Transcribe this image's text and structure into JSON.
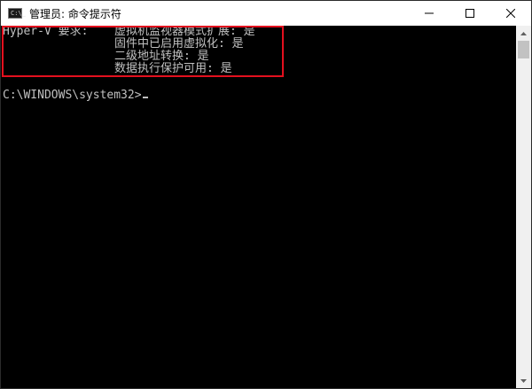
{
  "window": {
    "title": "管理员: 命令提示符",
    "app_icon_glyph": "C:\\_"
  },
  "console": {
    "hyper_v_label": "Hyper-V 要求:",
    "requirements": [
      "虚拟机监视器模式扩展: 是",
      "固件中已启用虚拟化: 是",
      "二级地址转换: 是",
      "数据执行保护可用: 是"
    ],
    "prompt": "C:\\WINDOWS\\system32>",
    "text_color": "#c0c0c0",
    "background_color": "#000000",
    "highlight_color": "#e3101e"
  }
}
